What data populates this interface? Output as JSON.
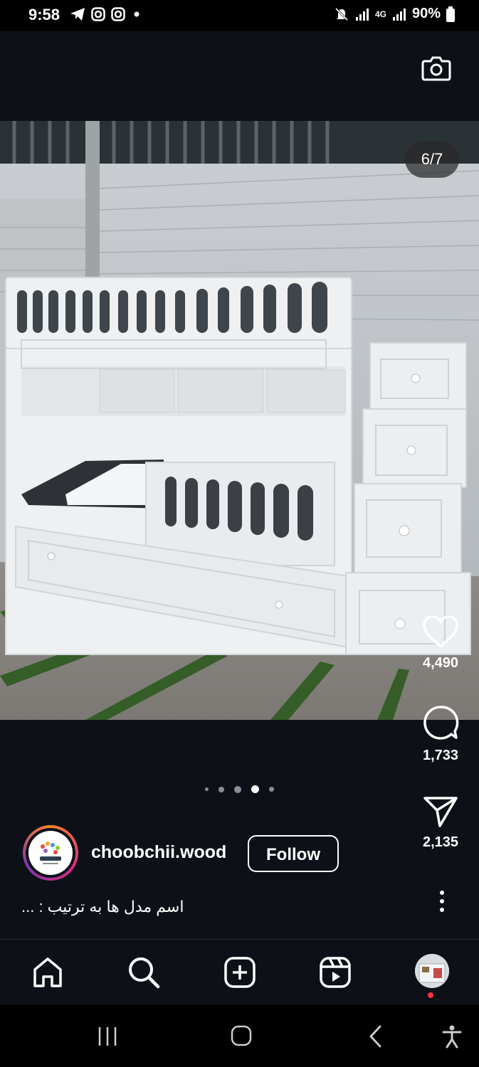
{
  "status_bar": {
    "time": "9:58",
    "battery": "90%",
    "network": "4G"
  },
  "post": {
    "counter": "6/7",
    "likes": "4,490",
    "comments": "1,733",
    "shares": "2,135",
    "carousel": {
      "dot_count": 5,
      "active_index": 3
    }
  },
  "account": {
    "username": "choobchii.wood",
    "follow_label": "Follow",
    "caption": "اسم مدل ها به ترتیب : ..."
  },
  "icons": {
    "camera": "camera-icon",
    "like": "heart-icon",
    "comment": "comment-icon",
    "share": "send-icon",
    "more": "more-vertical-icon",
    "home": "home-icon",
    "search": "search-icon",
    "create": "create-post-icon",
    "reels": "reels-icon"
  },
  "colors": {
    "background": "#0d1117",
    "story_ring_start": "#f58529",
    "story_ring_end": "#dd2a7b",
    "notification": "#ff3040"
  }
}
